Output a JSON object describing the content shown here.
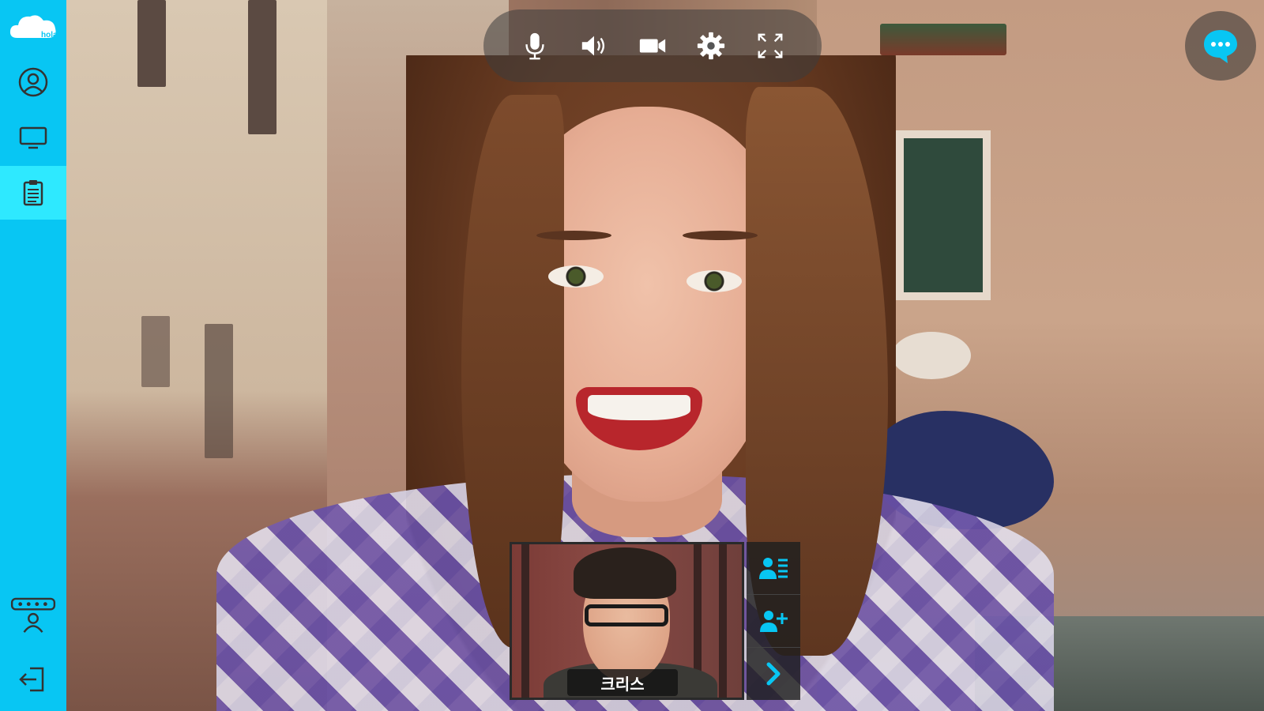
{
  "app": {
    "logo_text": "hola"
  },
  "sidebar": {
    "items": [
      {
        "name": "profile",
        "icon": "user-circle-icon"
      },
      {
        "name": "screen-share",
        "icon": "monitor-icon"
      },
      {
        "name": "notes",
        "icon": "clipboard-icon",
        "active": true
      },
      {
        "name": "conference",
        "icon": "conference-group-icon"
      },
      {
        "name": "exit",
        "icon": "logout-icon"
      }
    ],
    "accent": "#08c6f3",
    "active_color": "#2ee9ff"
  },
  "toolbar": {
    "buttons": [
      "microphone-icon",
      "speaker-icon",
      "camera-icon",
      "gear-icon",
      "fullscreen-icon"
    ]
  },
  "chat": {
    "icon": "chat-bubble-icon",
    "color": "#08c6f3"
  },
  "participant": {
    "name": "크리스",
    "actions": [
      "participant-list-icon",
      "add-participant-icon",
      "chevron-right-icon"
    ]
  }
}
